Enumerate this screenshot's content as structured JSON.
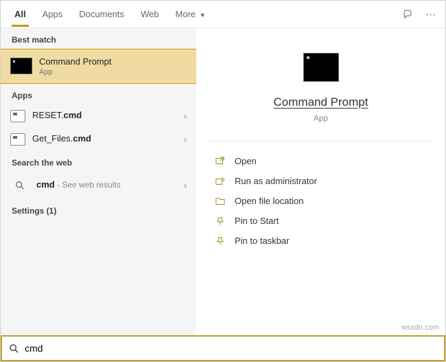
{
  "tabs": {
    "all": "All",
    "apps": "Apps",
    "documents": "Documents",
    "web": "Web",
    "more": "More"
  },
  "sections": {
    "best": "Best match",
    "apps": "Apps",
    "web": "Search the web",
    "settings": "Settings (1)"
  },
  "best": {
    "title": "Command Prompt",
    "sub": "App"
  },
  "apps_list": [
    {
      "prefix": "RESET.",
      "bold": "cmd"
    },
    {
      "prefix": "Get_Files.",
      "bold": "cmd"
    }
  ],
  "web_item": {
    "bold": "cmd",
    "hint": " - See web results"
  },
  "preview": {
    "title": "Command Prompt",
    "sub": "App"
  },
  "actions": {
    "open": "Open",
    "admin": "Run as administrator",
    "loc": "Open file location",
    "pin_start": "Pin to Start",
    "pin_task": "Pin to taskbar"
  },
  "search": {
    "value": "cmd"
  },
  "watermark": "wsxdn.com"
}
